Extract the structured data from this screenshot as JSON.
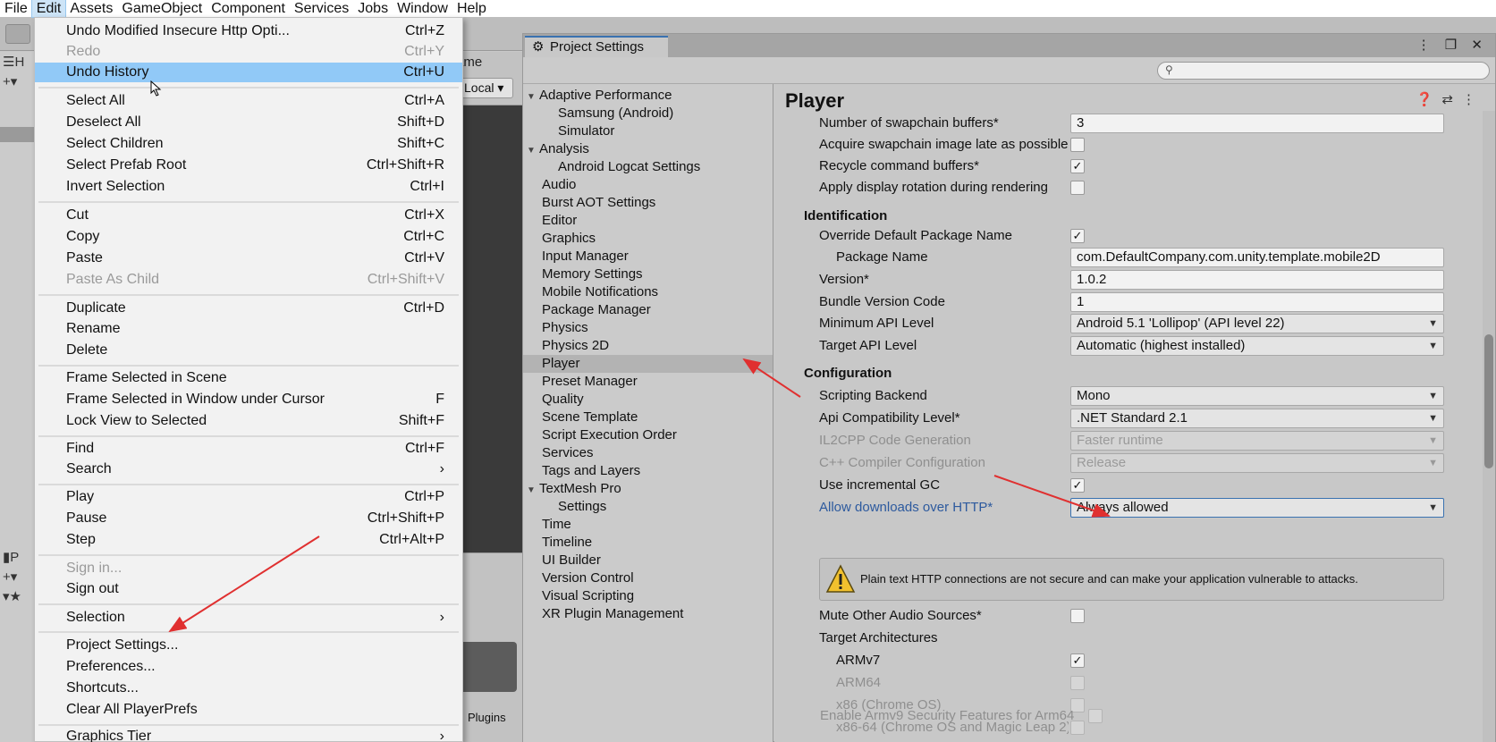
{
  "menubar": {
    "items": [
      "File",
      "Edit",
      "Assets",
      "GameObject",
      "Component",
      "Services",
      "Jobs",
      "Window",
      "Help"
    ]
  },
  "background": {
    "scene_tab_fragment": "ame",
    "local_dropdown": "Local",
    "left_fragments": [
      "H",
      "P"
    ],
    "plugins_label": "Plugins"
  },
  "edit_menu": {
    "items": [
      {
        "label": "Undo Modified Insecure Http Opti...",
        "shortcut": "Ctrl+Z"
      },
      {
        "label": "Redo",
        "shortcut": "Ctrl+Y"
      },
      {
        "label": "Undo History",
        "shortcut": "Ctrl+U"
      },
      {
        "label": "Select All",
        "shortcut": "Ctrl+A"
      },
      {
        "label": "Deselect All",
        "shortcut": "Shift+D"
      },
      {
        "label": "Select Children",
        "shortcut": "Shift+C"
      },
      {
        "label": "Select Prefab Root",
        "shortcut": "Ctrl+Shift+R"
      },
      {
        "label": "Invert Selection",
        "shortcut": "Ctrl+I"
      },
      {
        "label": "Cut",
        "shortcut": "Ctrl+X"
      },
      {
        "label": "Copy",
        "shortcut": "Ctrl+C"
      },
      {
        "label": "Paste",
        "shortcut": "Ctrl+V"
      },
      {
        "label": "Paste As Child",
        "shortcut": "Ctrl+Shift+V"
      },
      {
        "label": "Duplicate",
        "shortcut": "Ctrl+D"
      },
      {
        "label": "Rename",
        "shortcut": ""
      },
      {
        "label": "Delete",
        "shortcut": ""
      },
      {
        "label": "Frame Selected in Scene",
        "shortcut": ""
      },
      {
        "label": "Frame Selected in Window under Cursor",
        "shortcut": "F"
      },
      {
        "label": "Lock View to Selected",
        "shortcut": "Shift+F"
      },
      {
        "label": "Find",
        "shortcut": "Ctrl+F"
      },
      {
        "label": "Search",
        "shortcut": "›"
      },
      {
        "label": "Play",
        "shortcut": "Ctrl+P"
      },
      {
        "label": "Pause",
        "shortcut": "Ctrl+Shift+P"
      },
      {
        "label": "Step",
        "shortcut": "Ctrl+Alt+P"
      },
      {
        "label": "Sign in...",
        "shortcut": ""
      },
      {
        "label": "Sign out",
        "shortcut": ""
      },
      {
        "label": "Selection",
        "shortcut": "›"
      },
      {
        "label": "Project Settings...",
        "shortcut": ""
      },
      {
        "label": "Preferences...",
        "shortcut": ""
      },
      {
        "label": "Shortcuts...",
        "shortcut": ""
      },
      {
        "label": "Clear All PlayerPrefs",
        "shortcut": ""
      },
      {
        "label": "Graphics Tier",
        "shortcut": "›"
      }
    ]
  },
  "project_settings": {
    "tab_title": "Project Settings",
    "search_placeholder": "",
    "sidebar": [
      "Adaptive Performance",
      "Samsung (Android)",
      "Simulator",
      "Analysis",
      "Android Logcat Settings",
      "Audio",
      "Burst AOT Settings",
      "Editor",
      "Graphics",
      "Input Manager",
      "Memory Settings",
      "Mobile Notifications",
      "Package Manager",
      "Physics",
      "Physics 2D",
      "Player",
      "Preset Manager",
      "Quality",
      "Scene Template",
      "Script Execution Order",
      "Services",
      "Tags and Layers",
      "TextMesh Pro",
      "Settings",
      "Time",
      "Timeline",
      "UI Builder",
      "Version Control",
      "Visual Scripting",
      "XR Plugin Management"
    ],
    "player": {
      "title": "Player",
      "swapchain_label": "Number of swapchain buffers*",
      "swapchain_value": "3",
      "acquire_label": "Acquire swapchain image late as possible",
      "recycle_label": "Recycle command buffers*",
      "apply_rot_label": "Apply display rotation during rendering",
      "identification_header": "Identification",
      "override_pkg_label": "Override Default Package Name",
      "pkg_name_label": "Package Name",
      "pkg_name_value": "com.DefaultCompany.com.unity.template.mobile2D",
      "version_label": "Version*",
      "version_value": "1.0.2",
      "bundle_label": "Bundle Version Code",
      "bundle_value": "1",
      "min_api_label": "Minimum API Level",
      "min_api_value": "Android 5.1 'Lollipop' (API level 22)",
      "target_api_label": "Target API Level",
      "target_api_value": "Automatic (highest installed)",
      "configuration_header": "Configuration",
      "backend_label": "Scripting Backend",
      "backend_value": "Mono",
      "api_compat_label": "Api Compatibility Level*",
      "api_compat_value": ".NET Standard 2.1",
      "il2cpp_label": "IL2CPP Code Generation",
      "il2cpp_value": "Faster runtime",
      "cpp_label": "C++ Compiler Configuration",
      "cpp_value": "Release",
      "incgc_label": "Use incremental GC",
      "http_label": "Allow downloads over HTTP*",
      "http_value": "Always allowed",
      "warning": "Plain text HTTP connections are not secure and can make your application vulnerable to attacks.",
      "mute_label": "Mute Other Audio Sources*",
      "arch_label": "Target Architectures",
      "armv7_label": "ARMv7",
      "arm64_label": "ARM64",
      "x86_label": "x86 (Chrome OS)",
      "x8664_label": "x86-64 (Chrome OS and Magic Leap 2)",
      "armv9_label": "Enable Armv9 Security Features for Arm64",
      "checkmark": "✓"
    }
  }
}
